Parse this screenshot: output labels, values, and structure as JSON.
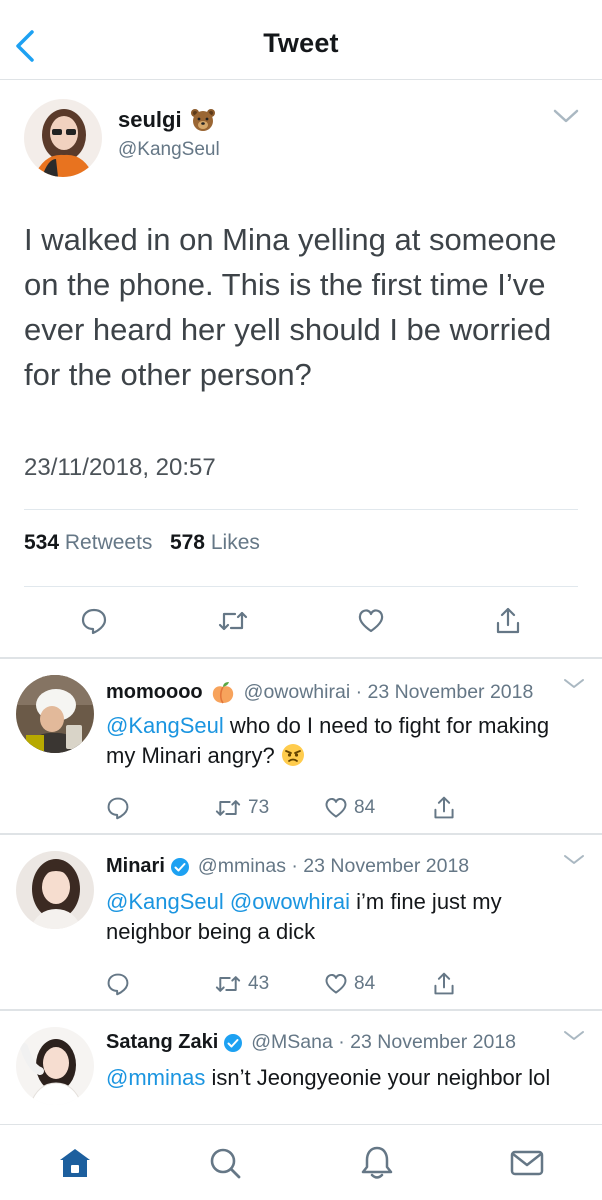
{
  "header": {
    "title": "Tweet"
  },
  "main_tweet": {
    "name": "seulgi",
    "handle": "@KangSeul",
    "text": "I walked in on Mina yelling at someone on the phone. This is the first time I’ve ever heard her yell should I be worried for the other person?",
    "timestamp": "23/11/2018, 20:57",
    "retweet_count": "534",
    "retweet_label": "Retweets",
    "like_count": "578",
    "like_label": "Likes"
  },
  "replies": [
    {
      "name": "momoooo",
      "meta": "@owowhirai · 23 November 2018",
      "mention": "@KangSeul",
      "text": " who do I need to fight for making my Minari angry? ",
      "retweets": "73",
      "likes": "84"
    },
    {
      "name": "Minari",
      "meta": "@mminas · 23 November 2018",
      "mention": "@KangSeul @owowhirai",
      "text": " i’m fine just my neighbor being a dick",
      "retweets": "43",
      "likes": "84"
    },
    {
      "name": "Satang Zaki",
      "meta": "@MSana · 23 November 2018",
      "mention": "@mminas",
      "text": " isn’t Jeongyeonie your neighbor lol"
    }
  ],
  "colors": {
    "accent": "#1da1f2",
    "link": "#1b95e0",
    "secondary": "#657786",
    "tab_active": "#1d5f9e"
  },
  "icons": [
    "back-icon",
    "chevron-down-icon",
    "reply-icon",
    "retweet-icon",
    "like-icon",
    "share-icon",
    "verified-icon",
    "home-icon",
    "search-icon",
    "notifications-icon",
    "messages-icon"
  ]
}
